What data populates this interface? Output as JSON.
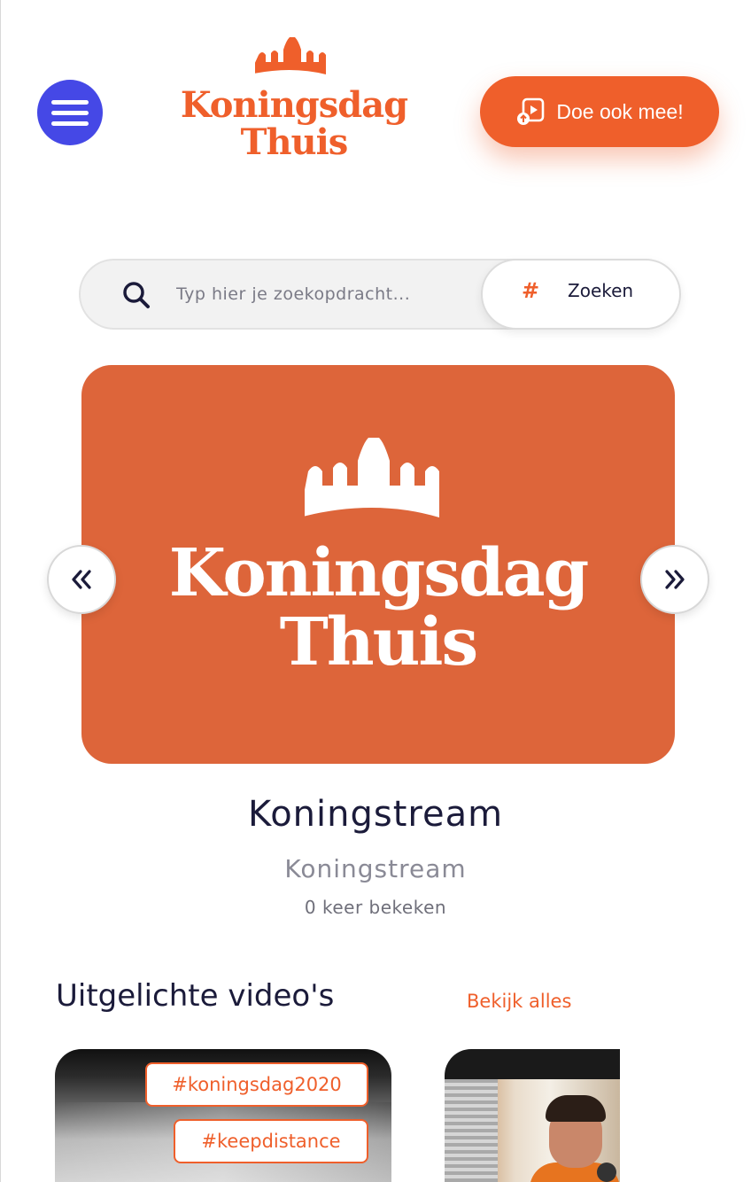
{
  "header": {
    "logo_line1": "Koningsdag",
    "logo_line2": "Thuis",
    "cta_label": "Doe ook mee!"
  },
  "search": {
    "placeholder": "Typ hier je zoekopdracht...",
    "hash_symbol": "#",
    "button_label": "Zoeken"
  },
  "carousel": {
    "slide_logo_line1": "Koningsdag",
    "slide_logo_line2": "Thuis",
    "prev_symbol": "«",
    "next_symbol": "»",
    "video_title": "Koningstream",
    "channel": "Koningstream",
    "views": "0 keer bekeken"
  },
  "featured": {
    "title": "Uitgelichte video's",
    "see_all": "Bekijk alles",
    "cards": [
      {
        "tags": [
          "#koningsdag2020",
          "#keepdistance"
        ]
      }
    ]
  },
  "colors": {
    "brand_orange": "#ef5f2b",
    "slide_orange": "#dd653a",
    "menu_blue": "#4548e6",
    "text_dark": "#1b1b3a"
  },
  "icons": [
    "menu-icon",
    "crown-icon",
    "video-upload-icon",
    "search-icon",
    "hash-icon",
    "double-chevron-left-icon",
    "double-chevron-right-icon"
  ]
}
